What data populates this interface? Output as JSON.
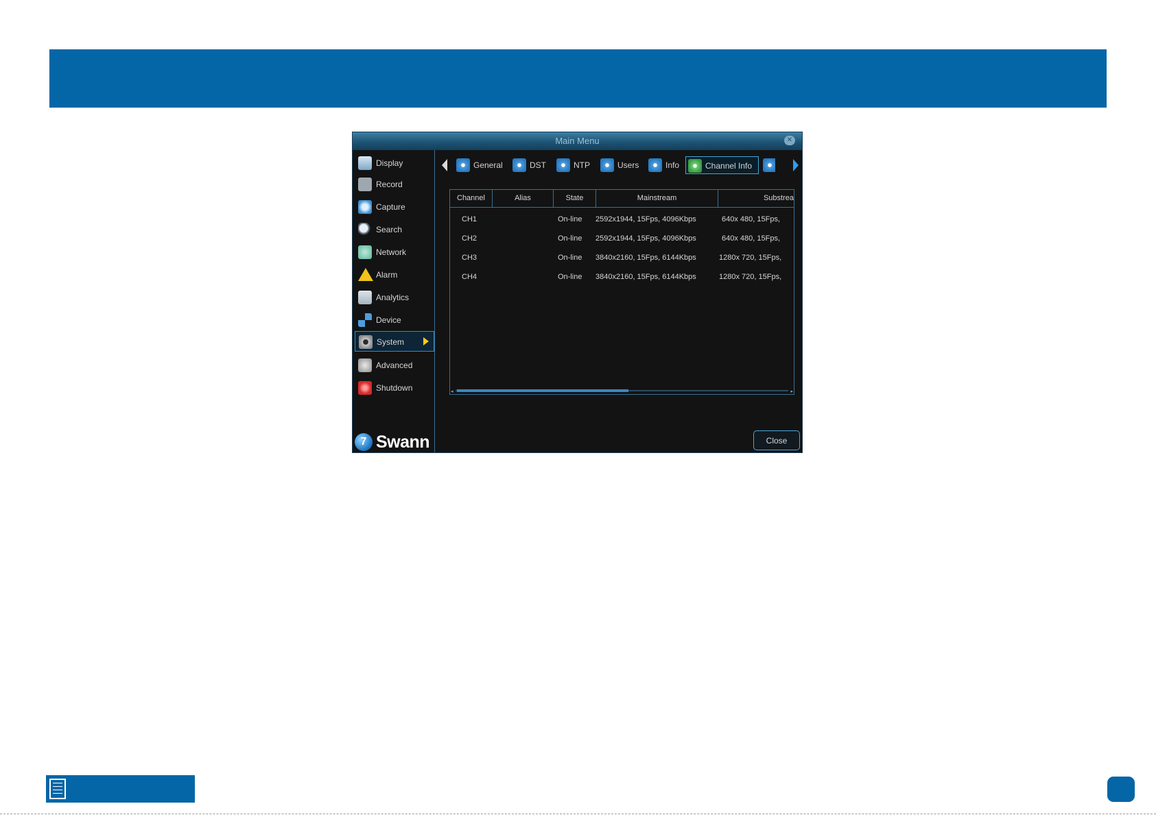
{
  "window": {
    "title": "Main Menu"
  },
  "sidebar": {
    "items": [
      {
        "label": "Display"
      },
      {
        "label": "Record"
      },
      {
        "label": "Capture"
      },
      {
        "label": "Search"
      },
      {
        "label": "Network"
      },
      {
        "label": "Alarm"
      },
      {
        "label": "Analytics"
      },
      {
        "label": "Device"
      },
      {
        "label": "System",
        "selected": true
      },
      {
        "label": "Advanced"
      },
      {
        "label": "Shutdown"
      }
    ],
    "logo_text": "Swann"
  },
  "tabs": [
    {
      "label": "General"
    },
    {
      "label": "DST"
    },
    {
      "label": "NTP"
    },
    {
      "label": "Users"
    },
    {
      "label": "Info"
    },
    {
      "label": "Channel Info",
      "active": true
    }
  ],
  "table": {
    "columns": [
      "Channel",
      "Alias",
      "State",
      "Mainstream",
      "Substrea"
    ],
    "rows": [
      {
        "channel": "CH1",
        "alias": "",
        "state": "On-line",
        "mainstream": "2592x1944, 15Fps, 4096Kbps",
        "substream": "640x 480, 15Fps,"
      },
      {
        "channel": "CH2",
        "alias": "",
        "state": "On-line",
        "mainstream": "2592x1944, 15Fps, 4096Kbps",
        "substream": "640x 480, 15Fps,"
      },
      {
        "channel": "CH3",
        "alias": "",
        "state": "On-line",
        "mainstream": "3840x2160, 15Fps, 6144Kbps",
        "substream": "1280x 720, 15Fps,"
      },
      {
        "channel": "CH4",
        "alias": "",
        "state": "On-line",
        "mainstream": "3840x2160, 15Fps, 6144Kbps",
        "substream": "1280x 720, 15Fps,"
      }
    ]
  },
  "buttons": {
    "close": "Close"
  },
  "colors": {
    "brand_blue": "#0466a6",
    "selection_border": "#2f8fc6",
    "active_arrow": "#f2cc1a"
  }
}
